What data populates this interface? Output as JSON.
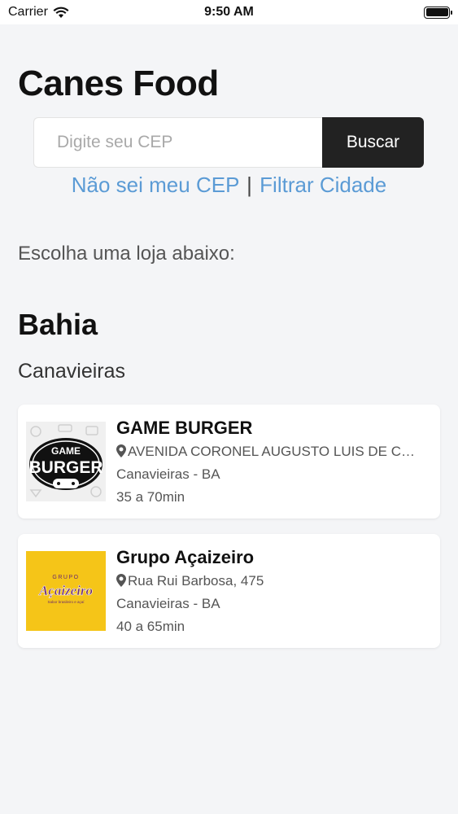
{
  "status_bar": {
    "carrier": "Carrier",
    "time": "9:50 AM"
  },
  "app": {
    "title": "Canes Food"
  },
  "search": {
    "placeholder": "Digite seu CEP",
    "value": "",
    "button_label": "Buscar"
  },
  "links": {
    "unknown_cep": "Não sei meu CEP",
    "separator": "|",
    "filter_city": "Filtrar Cidade"
  },
  "choose_label": "Escolha uma loja abaixo:",
  "state": "Bahia",
  "city": "Canavieiras",
  "stores": [
    {
      "name": "GAME BURGER",
      "address": "AVENIDA CORONEL AUGUSTO LUIS DE CARVALHO",
      "location": "Canavieiras - BA",
      "delivery_time": "35 a 70min",
      "logo": {
        "line1": "GAME",
        "line2": "BURGER"
      }
    },
    {
      "name": "Grupo Açaizeiro",
      "address": "Rua Rui Barbosa, 475",
      "location": "Canavieiras - BA",
      "delivery_time": "40 a 65min",
      "logo": {
        "line1": "GRUPO",
        "line2": "Açaizeiro",
        "line3": "Sabor brasileiro e açaí"
      }
    }
  ],
  "colors": {
    "link": "#5b9bd5",
    "button": "#222222",
    "background": "#f4f5f7",
    "acai_logo_bg": "#f5c518",
    "acai_logo_text": "#6b2a6e"
  },
  "icons": {
    "wifi": "wifi-icon",
    "battery": "battery-icon",
    "pin": "map-pin-icon"
  }
}
